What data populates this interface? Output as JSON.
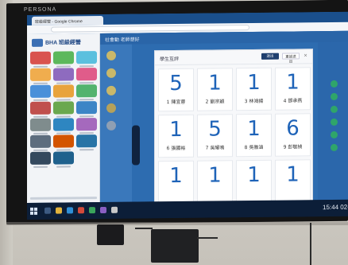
{
  "monitor": {
    "brand": "PERSONA"
  },
  "browser": {
    "tab_title": "班級經營 - Google Chrome",
    "app_logo_text": "BHA 班級經營"
  },
  "app": {
    "topbar_text": "社會動 老師想好"
  },
  "panel": {
    "title": "學生互評",
    "primary_button": "送出",
    "secondary_button": "重設送出",
    "close_symbol": "×",
    "students": [
      {
        "score": "5",
        "name": "1 陳宜蓉"
      },
      {
        "score": "1",
        "name": "2 劉宗穎"
      },
      {
        "score": "1",
        "name": "3 林鴻揚"
      },
      {
        "score": "1",
        "name": "4 鄧承燕"
      },
      {
        "score": "1",
        "name": "6 張國裕"
      },
      {
        "score": "5",
        "name": "7 吳耀鳴"
      },
      {
        "score": "1",
        "name": "8 吳雅涵"
      },
      {
        "score": "6",
        "name": "9 彭敬楨"
      },
      {
        "score": "1",
        "name": ""
      },
      {
        "score": "1",
        "name": ""
      },
      {
        "score": "1",
        "name": ""
      },
      {
        "score": "1",
        "name": ""
      }
    ]
  },
  "taskbar": {
    "clock": "15:44 02-2"
  },
  "colors": {
    "score_blue": "#1e63b8",
    "app_blue": "#2d6cb0",
    "taskbar": "#0c1e38"
  }
}
